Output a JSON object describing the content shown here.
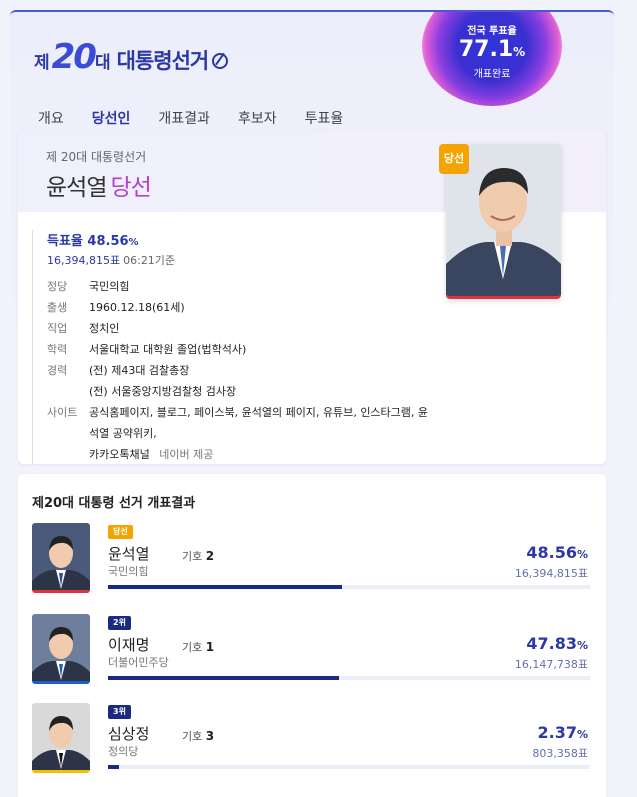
{
  "header": {
    "logo_pre": "제",
    "logo_num": "20",
    "logo_dae": "대",
    "logo_title": "대통령선거",
    "turnout_label": "전국 투표율",
    "turnout_value": "77.1",
    "turnout_unit": "%",
    "turnout_status": "개표완료"
  },
  "tabs": [
    "개요",
    "당선인",
    "개표결과",
    "후보자",
    "투표율"
  ],
  "active_tab": "당선인",
  "winner": {
    "subtitle": "제 20대 대통령선거",
    "name": "윤석열",
    "win_word": "당선",
    "badge": "당선",
    "rate_label": "득표율",
    "rate_value": "48.56",
    "rate_unit": "%",
    "votes": "16,394,815표",
    "time": "06:21기준",
    "details": [
      {
        "k": "정당",
        "v": "국민의힘"
      },
      {
        "k": "출생",
        "v": "1960.12.18(61세)"
      },
      {
        "k": "직업",
        "v": "정치인"
      },
      {
        "k": "학력",
        "v": "서울대학교 대학원 졸업(법학석사)"
      },
      {
        "k": "경력",
        "v": "(전) 제43대 검찰총장"
      },
      {
        "k": "",
        "v": "(전) 서울중앙지방검찰청 검사장"
      }
    ],
    "site_label": "사이트",
    "site_links": [
      "공식홈페이지",
      "블로그",
      "페이스북",
      "윤석열의 페이지",
      "유튜브",
      "인스타그램",
      "윤석열 공약위키",
      "카카오톡채널"
    ],
    "site_source": "네이버 제공"
  },
  "results": {
    "title": "제20대 대통령 선거 개표결과",
    "no_label": "기호",
    "pct_unit": "%",
    "candidates": [
      {
        "rank": "당선",
        "rank_color": "#f5a300",
        "name": "윤석열",
        "no": "2",
        "party": "국민의힘",
        "pct": "48.56",
        "pct_value": 48.56,
        "votes": "16,394,815표",
        "party_color": "#e0323c",
        "photo_bg": "#4a5a7a",
        "tie": "#2a4a9a"
      },
      {
        "rank": "2위",
        "rank_color": "#1a2a82",
        "name": "이재명",
        "no": "1",
        "party": "더불어민주당",
        "pct": "47.83",
        "pct_value": 47.83,
        "votes": "16,147,738표",
        "party_color": "#1f5fc8",
        "photo_bg": "#6d7f9d",
        "tie": "#1f5fc8"
      },
      {
        "rank": "3위",
        "rank_color": "#1a2a82",
        "name": "심상정",
        "no": "3",
        "party": "정의당",
        "pct": "2.37",
        "pct_value": 2.37,
        "votes": "803,358표",
        "party_color": "#f2c200",
        "photo_bg": "#d9d9d9",
        "tie": "#111111"
      }
    ]
  }
}
